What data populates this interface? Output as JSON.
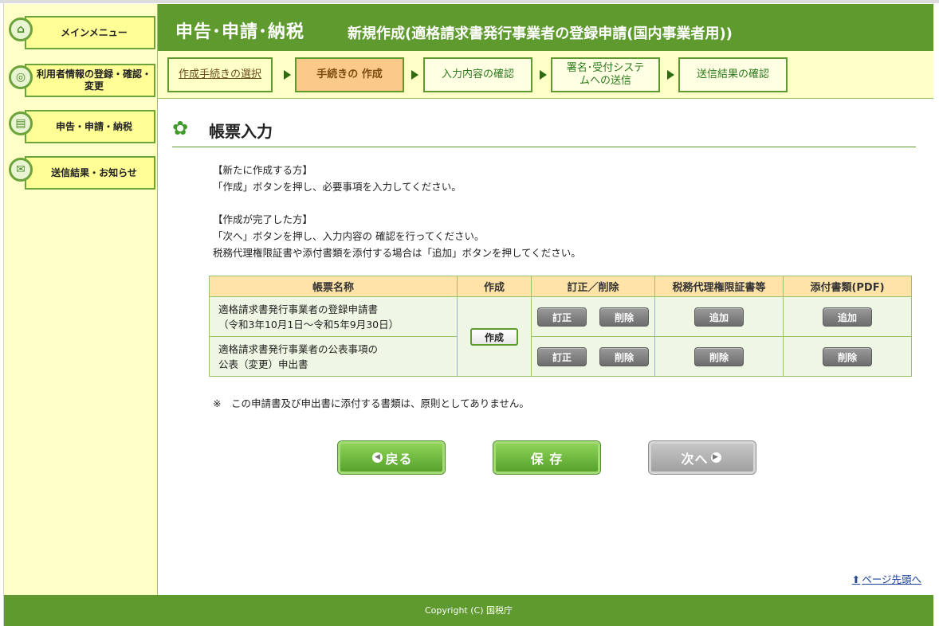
{
  "sidebar": {
    "items": [
      {
        "label": "メインメニュー",
        "icon": "home-icon"
      },
      {
        "label": "利用者情報の登録・確認・変更",
        "icon": "user-icon"
      },
      {
        "label": "申告・申請・納税",
        "icon": "document-icon"
      },
      {
        "label": "送信結果・お知らせ",
        "icon": "mail-icon"
      }
    ]
  },
  "header": {
    "title": "申告･申請･納税",
    "subtitle": "新規作成(適格請求書発行事業者の登録申請(国内事業者用))"
  },
  "steps": [
    {
      "label": "作成手続きの選択",
      "state": "done"
    },
    {
      "label": "手続きの 作成",
      "state": "active"
    },
    {
      "label": "入力内容の確認",
      "state": "pending"
    },
    {
      "label": "署名･受付システムへの送信",
      "state": "pending"
    },
    {
      "label": "送信結果の確認",
      "state": "pending"
    }
  ],
  "page": {
    "title": "帳票入力",
    "new_heading": "【新たに作成する方】",
    "new_text": "「作成」ボタンを押し、必要事項を入力してください。",
    "done_heading": "【作成が完了した方】",
    "done_text1": "「次へ」ボタンを押し、入力内容の 確認を行ってください。",
    "done_text2": "税務代理権限証書や添付書類を添付する場合は「追加」ボタンを押してください。"
  },
  "table": {
    "headers": [
      "帳票名称",
      "作成",
      "訂正／削除",
      "税務代理権限証書等",
      "添付書類(PDF)"
    ],
    "rows": [
      {
        "name_line1": "適格請求書発行事業者の登録申請書",
        "name_line2": "（令和3年10月1日～令和5年9月30日）",
        "edit": "訂正",
        "delete": "削除",
        "proxy": "追加",
        "attach": "追加"
      },
      {
        "name_line1": "適格請求書発行事業者の公表事項の",
        "name_line2": "公表（変更）申出書",
        "edit": "訂正",
        "delete": "削除",
        "proxy": "削除",
        "attach": "削除"
      }
    ],
    "create_label": "作成"
  },
  "note": "※　この申請書及び申出書に添付する書類は、原則としてありません。",
  "buttons": {
    "back": "戻る",
    "save": "保 存",
    "next": "次へ"
  },
  "page_top": "ページ先頭へ",
  "footer": "Copyright (C) 国税庁"
}
